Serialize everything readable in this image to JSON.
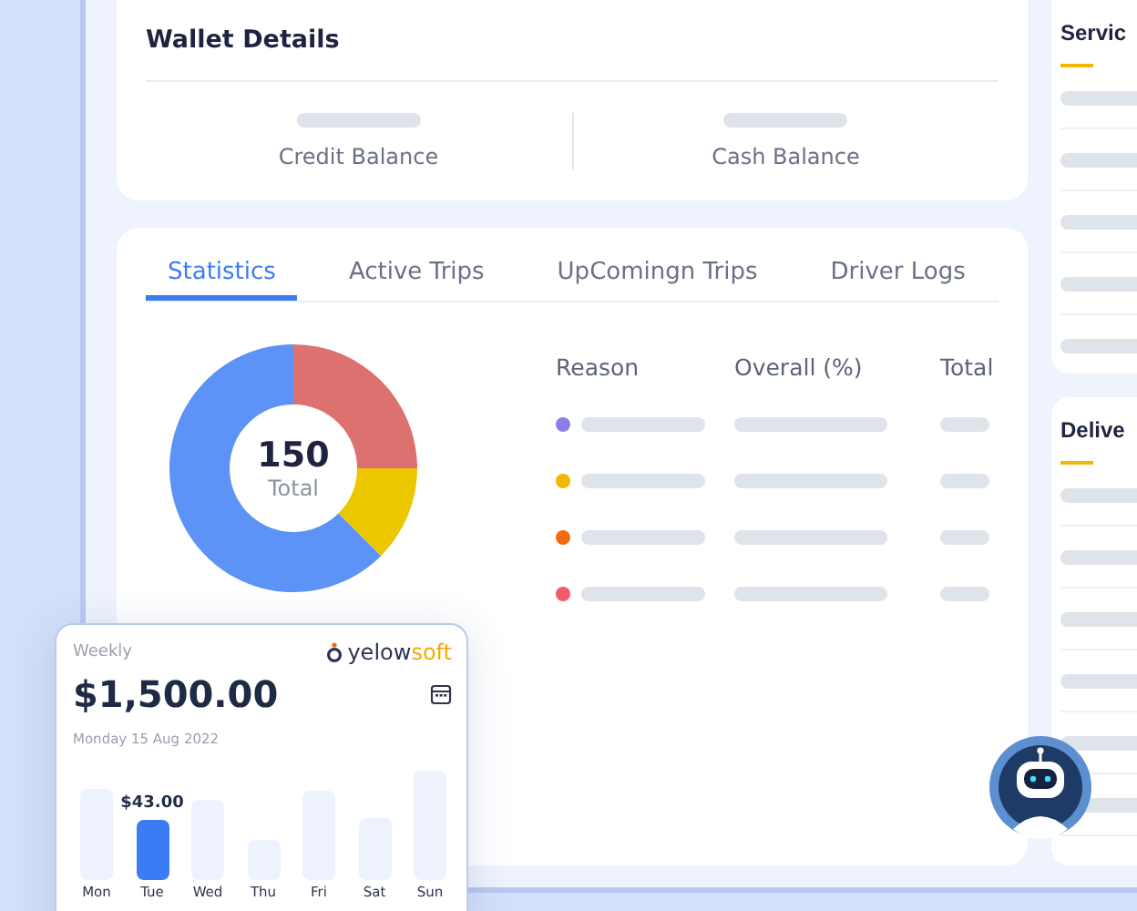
{
  "wallet": {
    "title": "Wallet Details",
    "balances": [
      {
        "label": "Credit Balance"
      },
      {
        "label": "Cash Balance"
      }
    ]
  },
  "tabs": [
    {
      "label": "Statistics",
      "selected": true
    },
    {
      "label": "Active Trips",
      "selected": false
    },
    {
      "label": "UpComingn Trips",
      "selected": false
    },
    {
      "label": "Driver Logs",
      "selected": false
    }
  ],
  "donut": {
    "value": "150",
    "label": "Total"
  },
  "table": {
    "columns": [
      "Reason",
      "Overall (%)",
      "Total"
    ],
    "rows": [
      {
        "color": "#8a7fe6"
      },
      {
        "color": "#f2b705"
      },
      {
        "color": "#f26b0f"
      },
      {
        "color": "#f25a6e"
      }
    ]
  },
  "side_cards": [
    {
      "title": "Servic"
    },
    {
      "title": "Delive"
    }
  ],
  "weekly": {
    "period": "Weekly",
    "logo": {
      "primary": "yelow",
      "accent": "soft"
    },
    "amount": "$1,500.00",
    "date": "Monday 15 Aug 2022",
    "days": [
      {
        "label": "Mon",
        "selected": false
      },
      {
        "label": "Tue",
        "selected": true,
        "value": "$43.00"
      },
      {
        "label": "Wed",
        "selected": false
      },
      {
        "label": "Thu",
        "selected": false
      },
      {
        "label": "Fri",
        "selected": false
      },
      {
        "label": "Sat",
        "selected": false
      },
      {
        "label": "Sun",
        "selected": false
      }
    ]
  }
}
